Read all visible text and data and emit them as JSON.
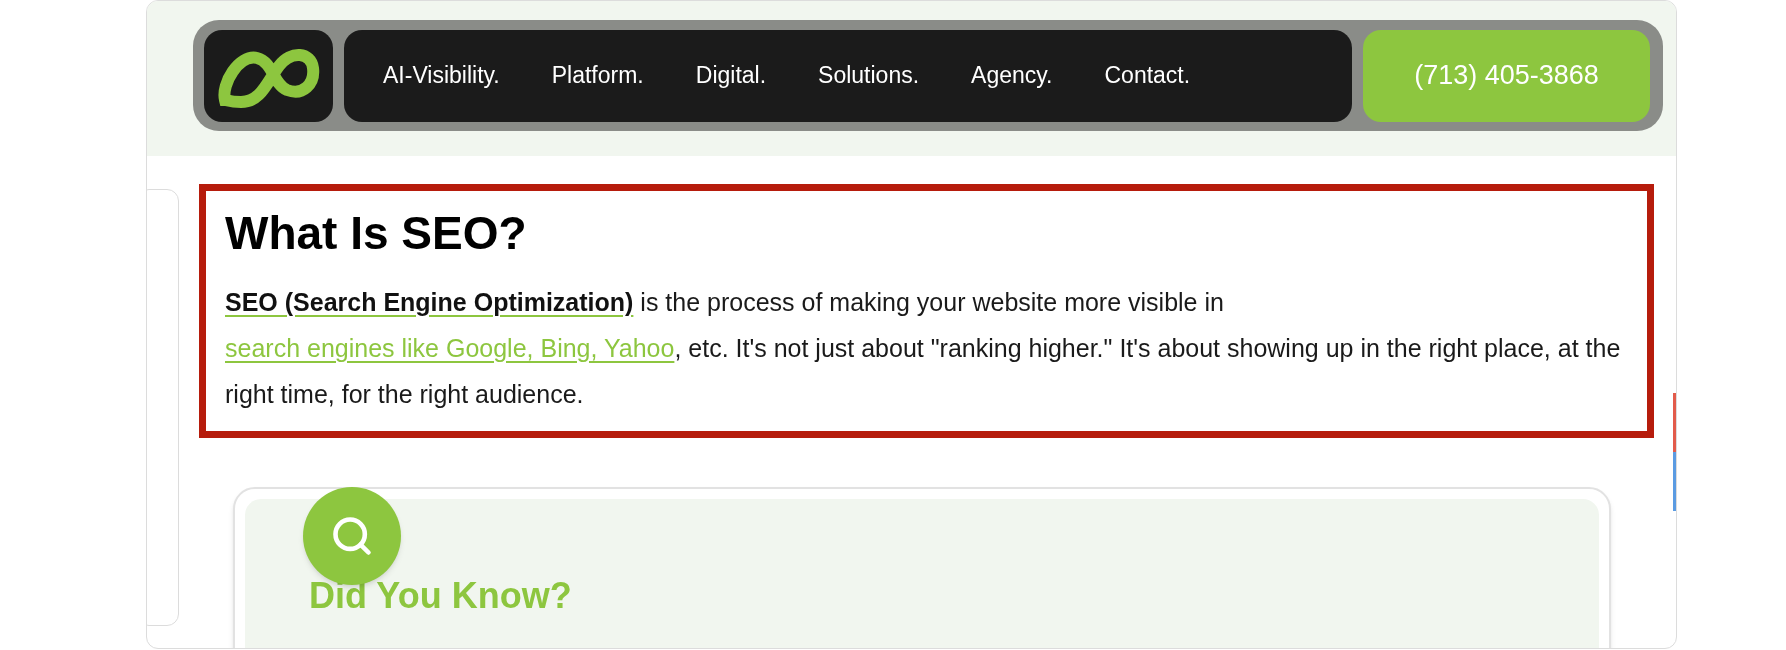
{
  "nav": {
    "items": [
      "AI-Visibility.",
      "Platform.",
      "Digital.",
      "Solutions.",
      "Agency.",
      "Contact."
    ],
    "phone": "(713) 405-3868"
  },
  "section": {
    "title": "What Is SEO?",
    "paragraph": [
      {
        "kind": "bold-link",
        "text": "SEO (Search Engine Optimization)"
      },
      {
        "kind": "text",
        "text": " is the process of making your website more visible in "
      },
      {
        "kind": "link",
        "text": "search engines like Google, Bing, Yahoo"
      },
      {
        "kind": "text",
        "text": ", etc. It's not just about \"ranking higher.\" It's about showing up in the right place, at the right time, for the right audience."
      }
    ]
  },
  "card": {
    "title": "Did You Know?"
  }
}
